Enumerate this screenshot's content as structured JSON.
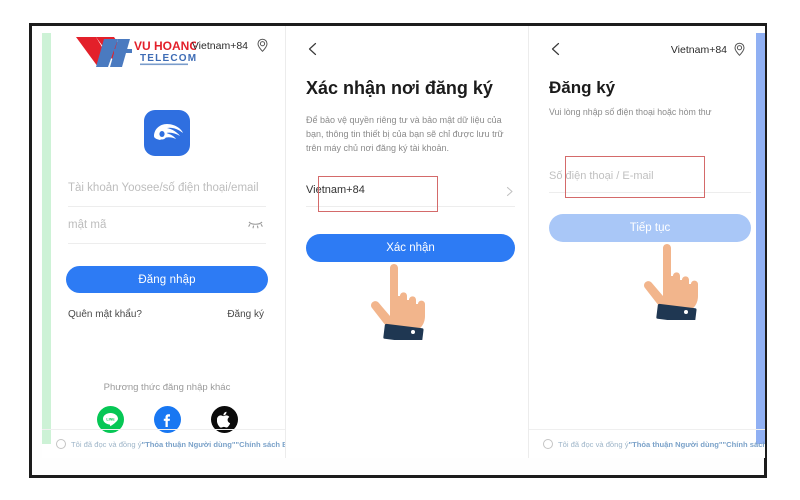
{
  "brand": {
    "name_line1": "VU HOANG",
    "name_line2": "TELECOM",
    "mark_colors": {
      "red": "#e3202a",
      "blue": "#3e6cb5"
    }
  },
  "colors": {
    "primary_blue": "#2d7bf4",
    "disabled_blue": "#a9c7f7",
    "highlight_red": "#e03030",
    "box_red": "#d46a6a",
    "strip_green": "#cdf2d6",
    "strip_blue": "#90b0f3",
    "app_icon_blue": "#2f6fe0"
  },
  "panel_login": {
    "locale": "Vietnam+84",
    "pin_icon": "location-pin-icon",
    "app_icon": "yoosee-app-icon",
    "account_placeholder": "Tài khoản Yoosee/số điện thoại/email",
    "password_placeholder": "mật mã",
    "eye_icon": "eye-closed-icon",
    "login_button": "Đăng nhập",
    "forgot_link": "Quên mật khẩu?",
    "register_link": "Đăng ký",
    "other_methods_label": "Phương thức đăng nhập khác",
    "socials": [
      {
        "name": "line-icon",
        "label": "LINE",
        "color": "#06c755"
      },
      {
        "name": "facebook-icon",
        "label": "Facebook",
        "color": "#1877f2"
      },
      {
        "name": "apple-icon",
        "label": "Apple",
        "color": "#0b0b0b"
      }
    ],
    "terms_prefix": "Tôi đã đọc và đồng ý",
    "terms_link1": "\"Thỏa thuận Người dùng\"",
    "terms_link2": "\"Chính sách Bảo mật\""
  },
  "panel_confirm": {
    "back_icon": "back-chevron-icon",
    "title": "Xác nhận nơi đăng ký",
    "description": "Để bảo vệ quyền riêng tư và bảo mật dữ liệu của bạn, thông tin thiết bị của bạn sẽ chỉ được lưu trữ trên máy chủ nơi đăng ký tài khoản.",
    "region_value": "Vietnam+84",
    "chevron_icon": "chevron-right-icon",
    "confirm_button": "Xác nhận",
    "hand_icon": "pointing-hand-cursor"
  },
  "panel_register": {
    "back_icon": "back-chevron-icon",
    "locale": "Vietnam+84",
    "pin_icon": "location-pin-icon",
    "title": "Đăng ký",
    "description": "Vui lòng nhập số điện thoại hoặc hòm thư",
    "input_placeholder": "Số điện thoại / E-mail",
    "continue_button": "Tiếp tục",
    "hand_icon": "pointing-hand-cursor",
    "terms_prefix": "Tôi đã đọc và đồng ý",
    "terms_link1": "\"Thỏa thuận Người dùng\"",
    "terms_link2": "\"Chính sách Bảo mậ"
  }
}
